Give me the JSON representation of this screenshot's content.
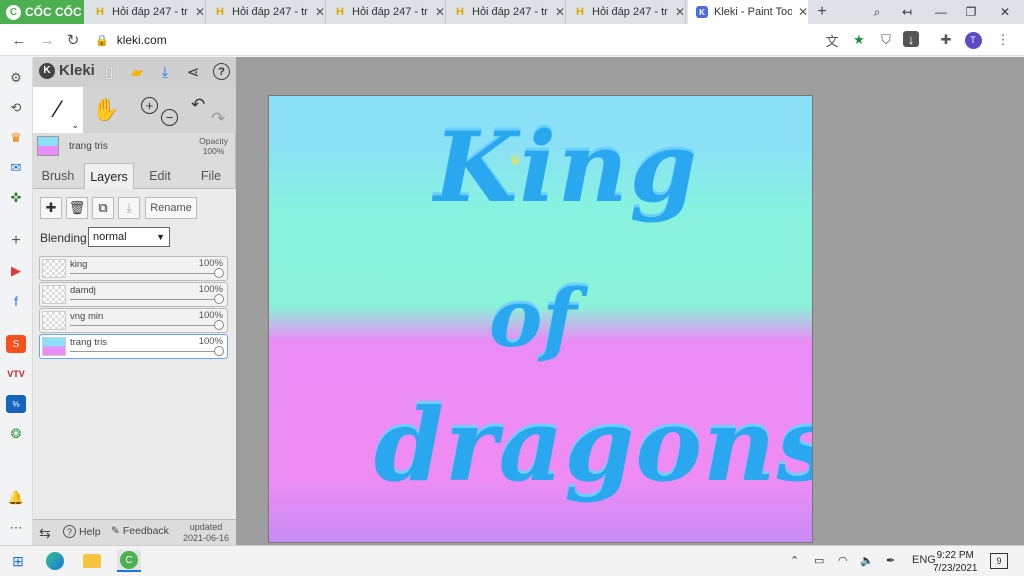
{
  "browser": {
    "brand": "CỐC CỐC",
    "tabs": [
      {
        "title": "Hỏi đáp 247 - tr",
        "active": false
      },
      {
        "title": "Hỏi đáp 247 - tr",
        "active": false
      },
      {
        "title": "Hỏi đáp 247 - tr",
        "active": false
      },
      {
        "title": "Hỏi đáp 247 - tr",
        "active": false
      },
      {
        "title": "Hỏi đáp 247 - tr",
        "active": false
      },
      {
        "title": "Kleki - Paint Too",
        "active": true
      }
    ],
    "address": "kleki.com",
    "profile_initial": "T"
  },
  "kleki": {
    "logo": "Kleki",
    "current_layer": {
      "name": "trang tris",
      "opacity_label": "Opacity",
      "opacity_value": "100%"
    },
    "panel_tabs": [
      "Brush",
      "Layers",
      "Edit",
      "File"
    ],
    "active_tab": "Layers",
    "rename_label": "Rename",
    "blending_label": "Blending",
    "blending_value": "normal",
    "layers": [
      {
        "name": "king",
        "opacity": "100%"
      },
      {
        "name": "damdj",
        "opacity": "100%"
      },
      {
        "name": "vng min",
        "opacity": "100%"
      },
      {
        "name": "trang tris",
        "opacity": "100%"
      }
    ],
    "footer": {
      "help": "Help",
      "feedback": "Feedback",
      "updated_label": "updated",
      "updated_date": "2021-06-16"
    }
  },
  "canvas": {
    "line1": "King",
    "line2": "of",
    "line3": "dragons"
  },
  "taskbar": {
    "language": "ENG",
    "time": "9:22 PM",
    "date": "7/23/2021",
    "notifications": "9"
  }
}
